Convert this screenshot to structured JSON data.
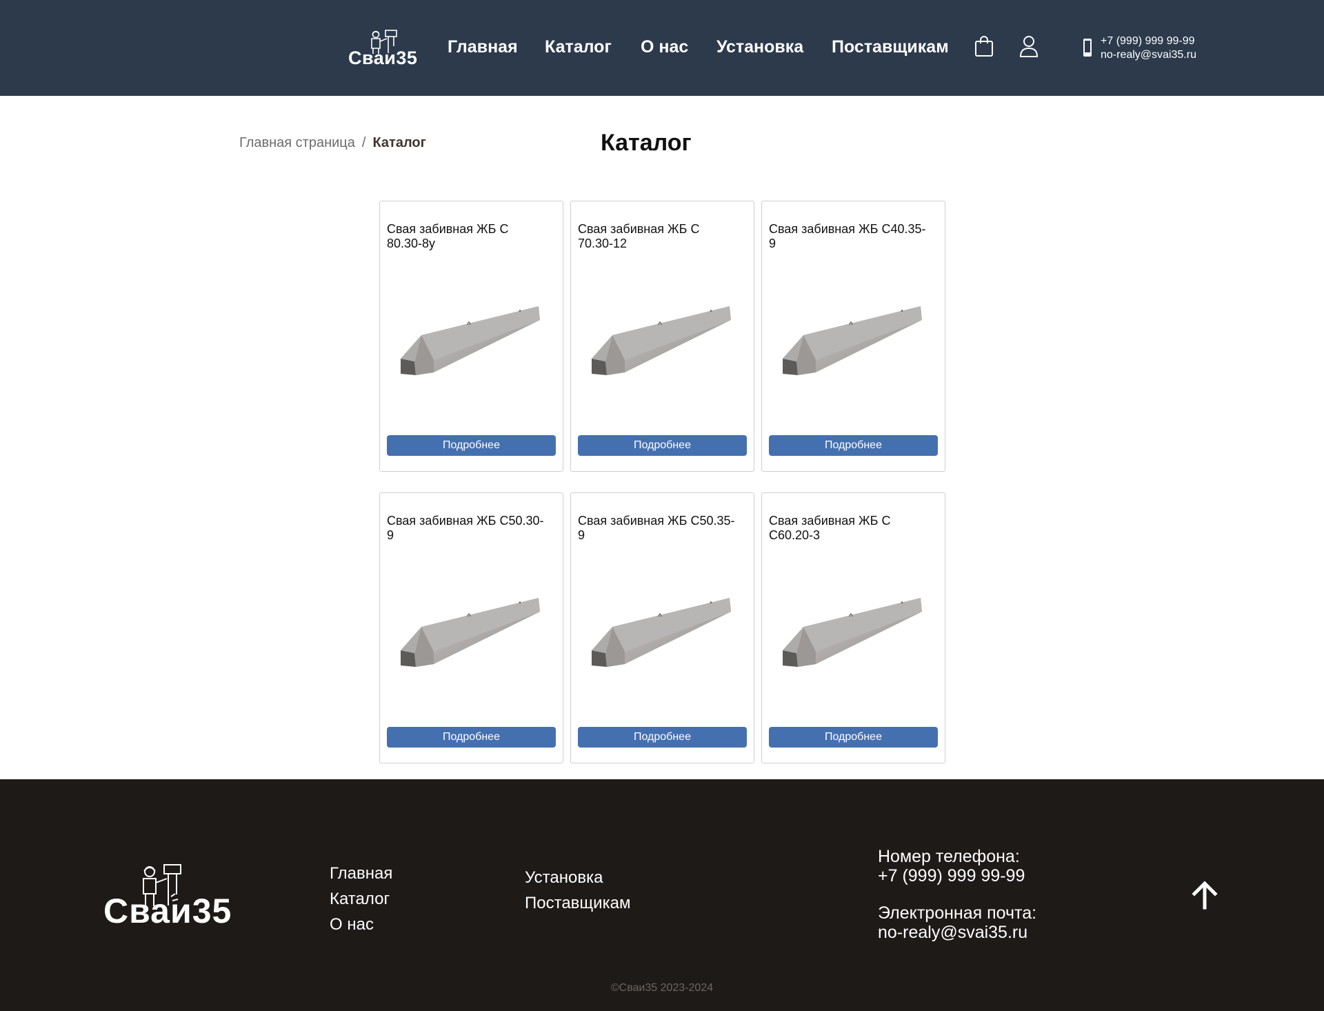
{
  "header": {
    "logo_text": "Сваи35",
    "nav": [
      "Главная",
      "Каталог",
      "О нас",
      "Установка",
      "Поставщикам"
    ],
    "phone": "+7 (999) 999 99-99",
    "email": "no-realy@svai35.ru",
    "icons": [
      "cart-icon",
      "user-icon",
      "phone-icon"
    ]
  },
  "breadcrumb": {
    "home": "Главная страница",
    "separator": "/",
    "current": "Каталог"
  },
  "page_title": "Каталог",
  "products": [
    {
      "name": "Свая забивная ЖБ С 80.30-8у",
      "button": "Подробнее"
    },
    {
      "name": "Свая забивная ЖБ С 70.30-12",
      "button": "Подробнее"
    },
    {
      "name": "Свая забивная ЖБ С40.35-9",
      "button": "Подробнее"
    },
    {
      "name": "Свая забивная ЖБ С50.30-9",
      "button": "Подробнее"
    },
    {
      "name": "Свая забивная ЖБ С50.35-9",
      "button": "Подробнее"
    },
    {
      "name": "Свая забивная ЖБ С С60.20-3",
      "button": "Подробнее"
    }
  ],
  "footer": {
    "logo_text": "Сваи35",
    "nav_col1": [
      "Главная",
      "Каталог",
      "О нас"
    ],
    "nav_col2": [
      "Установка",
      "Поставщикам"
    ],
    "phone_label": "Номер телефона:",
    "phone": "+7 (999) 999 99-99",
    "email_label": "Электронная почта:",
    "email": "no-realy@svai35.ru",
    "copyright": "©Сваи35 2023-2024"
  },
  "colors": {
    "header_bg": "#2c3a4c",
    "footer_bg": "#1e1a18",
    "button_bg": "#4570b0"
  }
}
